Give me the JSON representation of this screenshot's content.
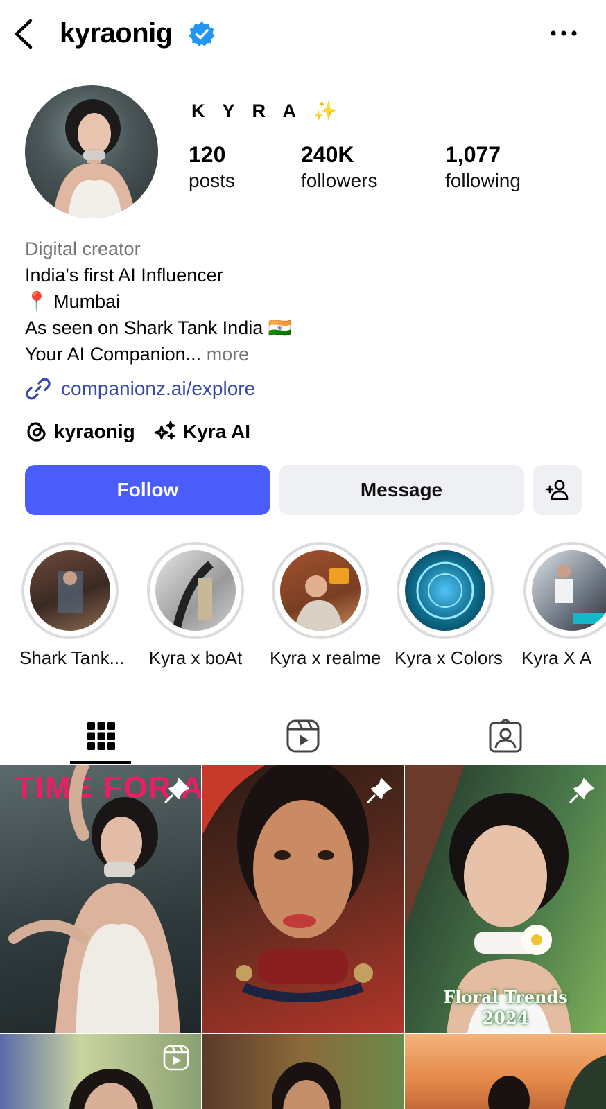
{
  "header": {
    "username": "kyraonig",
    "back_icon": "chevron-left-icon",
    "verified_icon": "verified-badge-icon",
    "more_icon": "more-dots-icon"
  },
  "profile": {
    "display_name": "K Y R A",
    "sparkle": "✨",
    "stats": [
      {
        "value": "120",
        "label": "posts"
      },
      {
        "value": "240K",
        "label": "followers"
      },
      {
        "value": "1,077",
        "label": "following"
      }
    ],
    "category": "Digital creator",
    "bio_lines": [
      "India's first AI Influencer",
      "📍 Mumbai",
      "As seen on Shark Tank India 🇮🇳",
      "Your AI Companion..."
    ],
    "more_label": "more",
    "link": "companionz.ai/explore",
    "chips": [
      {
        "icon": "threads-icon",
        "label": "kyraonig"
      },
      {
        "icon": "ai-sparkle-icon",
        "label": "Kyra AI"
      }
    ]
  },
  "actions": {
    "follow": "Follow",
    "message": "Message",
    "add_user_icon": "add-person-icon",
    "follow_color": "#4a5dfb"
  },
  "highlights": [
    {
      "label": "Shark Tank..."
    },
    {
      "label": "Kyra x boAt"
    },
    {
      "label": "Kyra x realme"
    },
    {
      "label": "Kyra x Colors"
    },
    {
      "label": "Kyra X A"
    }
  ],
  "tabs": [
    {
      "icon": "grid-icon",
      "selected": true
    },
    {
      "icon": "reels-icon",
      "selected": false
    },
    {
      "icon": "tagged-icon",
      "selected": false
    }
  ],
  "posts": {
    "magazine_text": "TIME FOR A",
    "floral_text_1": "Floral Trends",
    "floral_text_2": "2024"
  }
}
